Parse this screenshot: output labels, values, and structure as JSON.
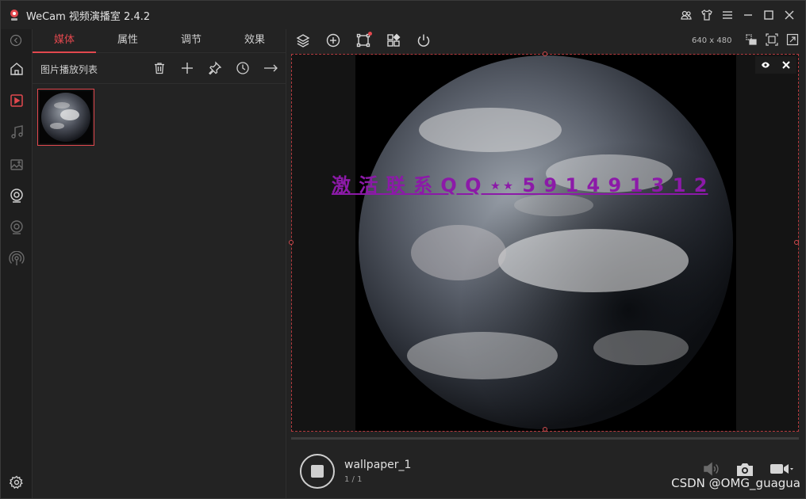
{
  "app": {
    "title": "WeCam 视频演播室 2.4.2",
    "accent": "#e2484e"
  },
  "titlebar": {
    "icons": [
      "users-icon",
      "shirt-icon",
      "menu-icon",
      "minimize-icon",
      "maximize-icon",
      "close-icon"
    ]
  },
  "rail": {
    "items": [
      "home-icon",
      "video-icon",
      "music-icon",
      "image-icon",
      "webcam-icon",
      "camera-icon",
      "broadcast-icon",
      "settings-icon"
    ],
    "active": "video-icon"
  },
  "panel": {
    "tabs": [
      {
        "label": "媒体",
        "active": true
      },
      {
        "label": "属性",
        "active": false
      },
      {
        "label": "调节",
        "active": false
      },
      {
        "label": "效果",
        "active": false
      }
    ],
    "list_title": "图片播放列表",
    "tools": [
      "trash-icon",
      "plus-icon",
      "pin-icon",
      "clock-icon",
      "arrow-right-icon"
    ]
  },
  "toolbar": {
    "icons": [
      "layers-icon",
      "add-circle-icon",
      "crop-icon",
      "widgets-icon",
      "power-icon"
    ],
    "resolution": "640 x 480",
    "right_icons": [
      "layout-icon",
      "fit-icon",
      "fullscreen-icon"
    ]
  },
  "preview": {
    "watermark": "激 活 联 系 Q Q ⋆⋆ 5 9 1 4 9 1 3 1 2",
    "controls": [
      "eye-icon",
      "close-icon"
    ]
  },
  "player": {
    "name": "wallpaper_1",
    "count": "1 / 1",
    "icons": [
      "volume-icon",
      "snapshot-icon",
      "record-icon"
    ]
  },
  "credit": "CSDN @OMG_guagua"
}
